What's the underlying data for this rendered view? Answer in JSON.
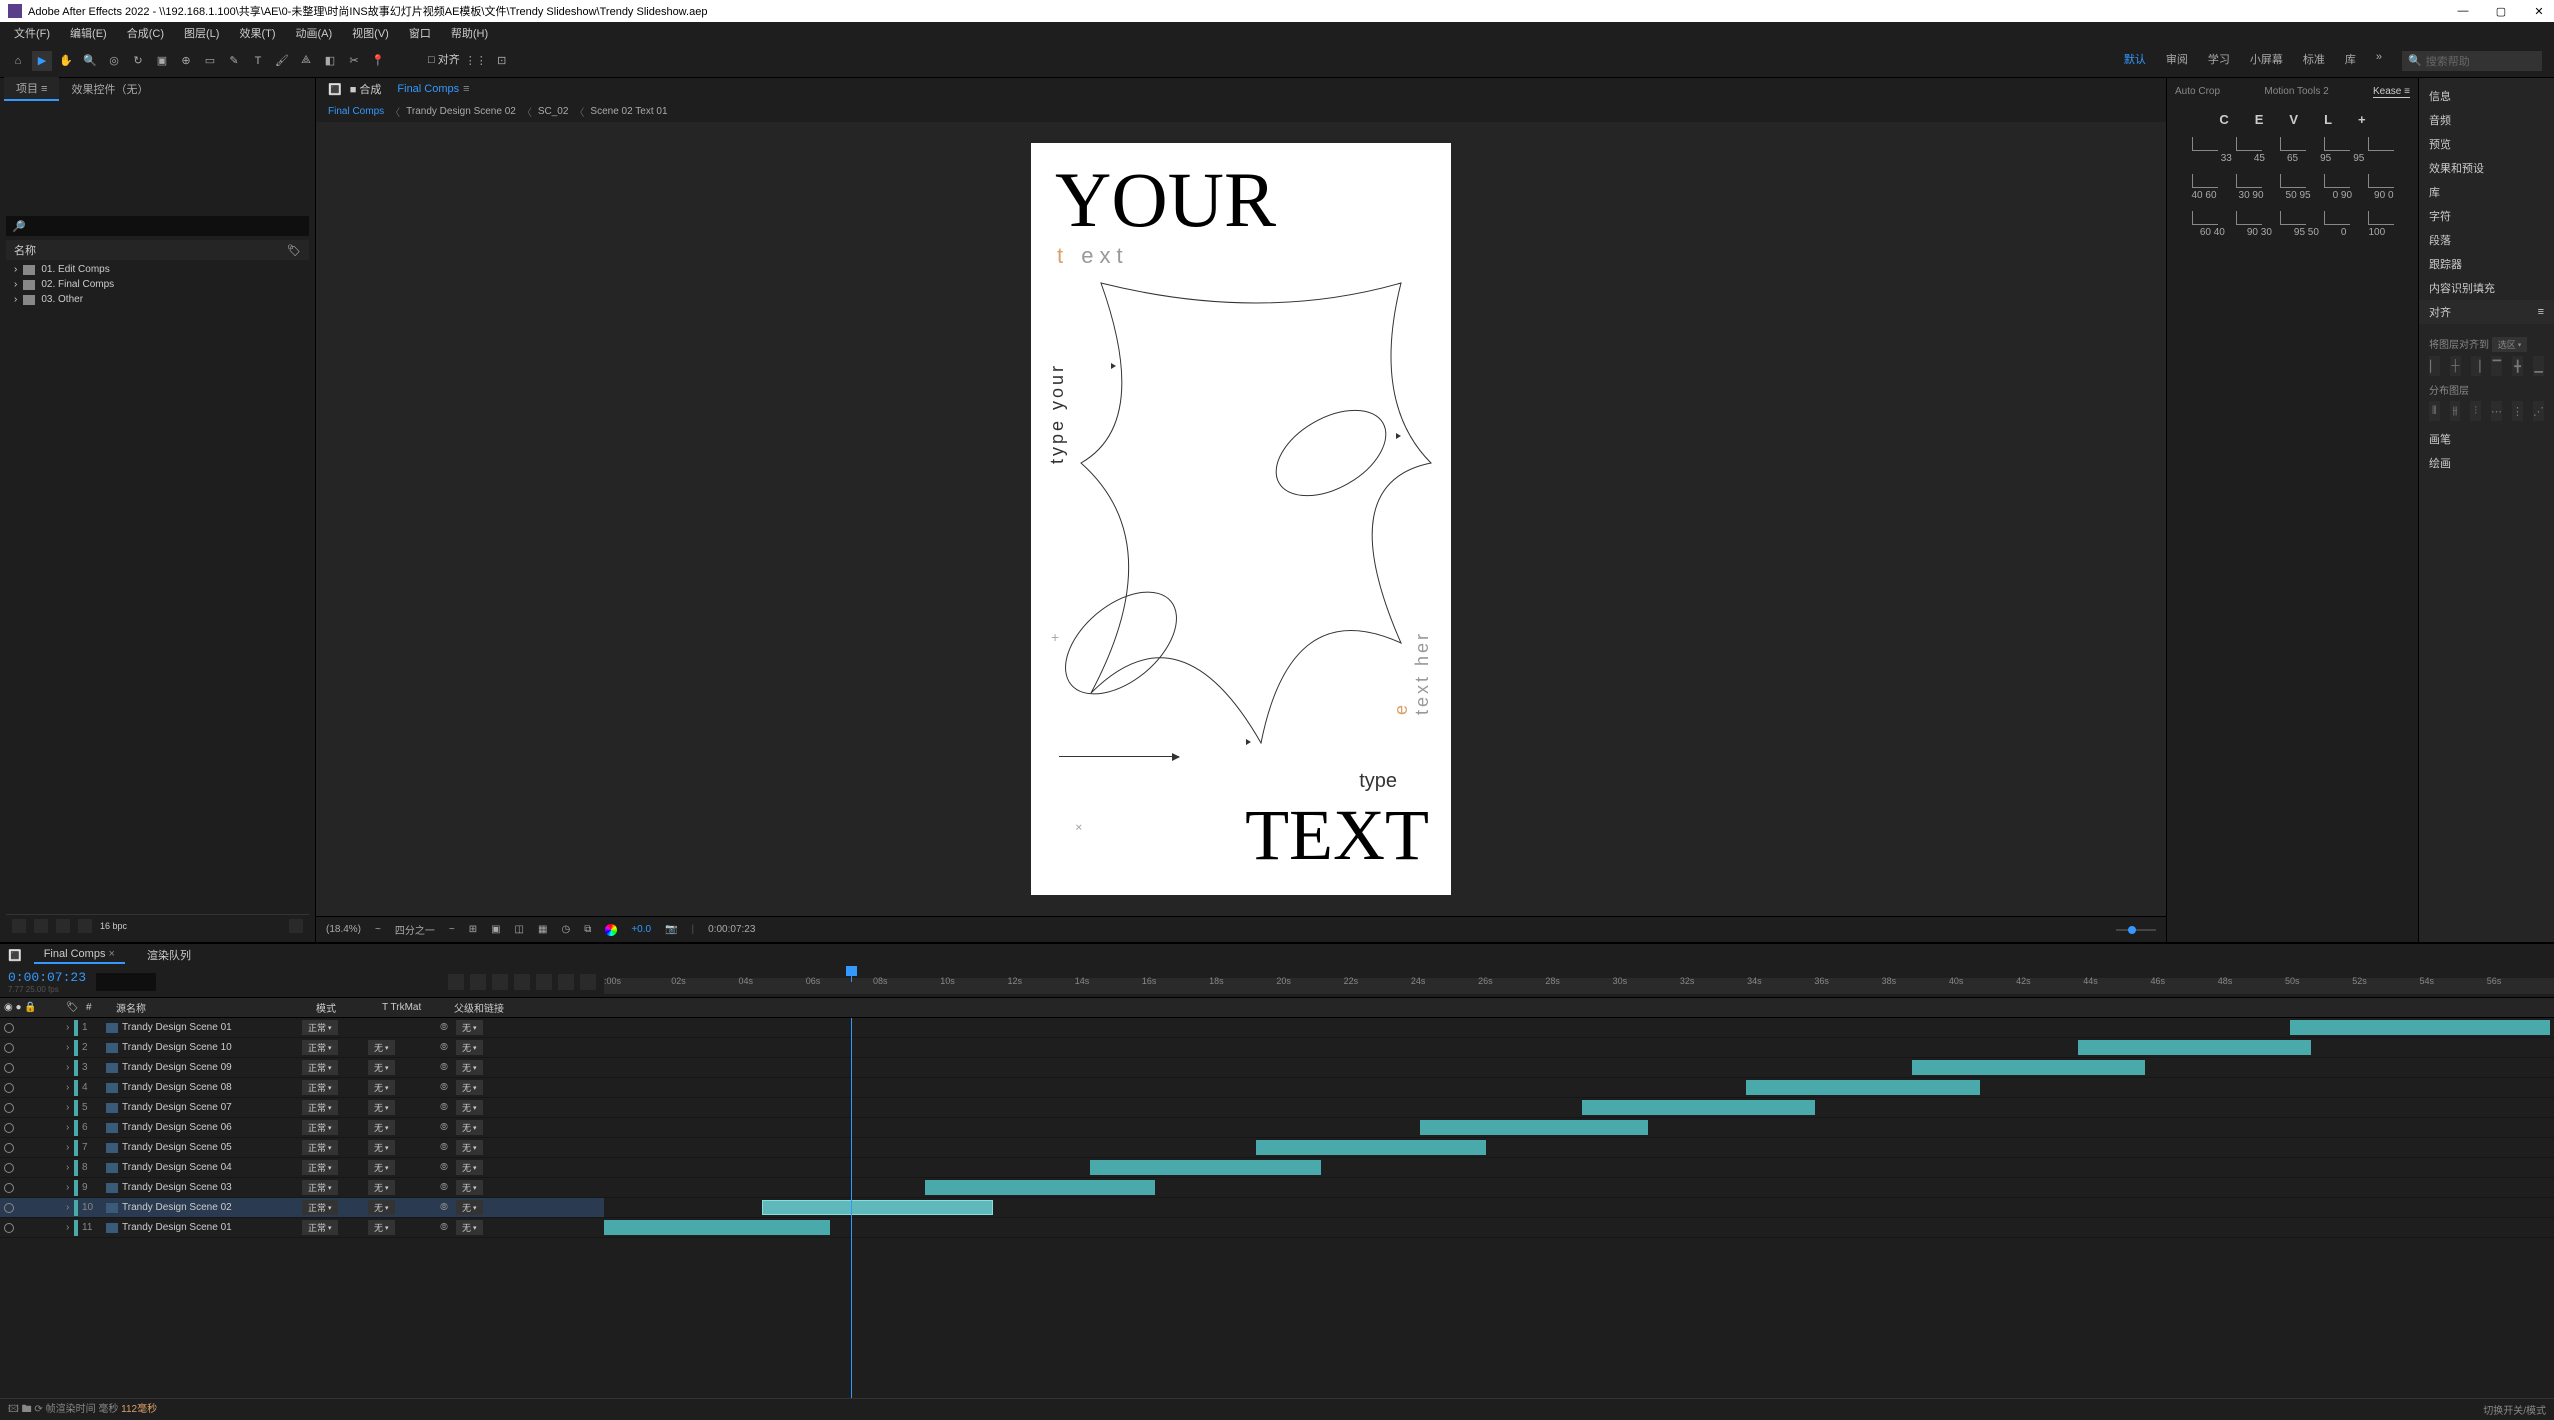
{
  "app": {
    "title": "Adobe After Effects 2022 - \\\\192.168.1.100\\共享\\AE\\0-未整理\\时尚INS故事幻灯片视频AE模板\\文件\\Trendy Slideshow\\Trendy Slideshow.aep"
  },
  "menu": [
    "文件(F)",
    "编辑(E)",
    "合成(C)",
    "图层(L)",
    "效果(T)",
    "动画(A)",
    "视图(V)",
    "窗口",
    "帮助(H)"
  ],
  "toolbar": {
    "snap_label": "□ 对齐",
    "workspaces": [
      "默认",
      "审阅",
      "学习",
      "小屏幕",
      "标准",
      "库"
    ],
    "search_placeholder": "搜索帮助"
  },
  "project": {
    "tab1": "项目 ≡",
    "tab2": "效果控件（无）",
    "header": "名称",
    "items": [
      "01. Edit Comps",
      "02. Final Comps",
      "03. Other"
    ],
    "footer_label": "16 bpc"
  },
  "comp": {
    "prefix": "■ 合成",
    "active_tab": "Final Comps",
    "breadcrumb": [
      "Final Comps",
      "Trandy Design Scene 02",
      "SC_02",
      "Scene 02 Text 01"
    ],
    "canvas": {
      "your": "YOUR",
      "subtext_l": "t ",
      "subtext_r": "ext",
      "vert_left": "type your",
      "vert_right_top": "e",
      "vert_right_bot": "text her",
      "type": "type",
      "big_text": "TEXT"
    },
    "footer": {
      "zoom": "(18.4%)",
      "res": "四分之一",
      "time": "0:00:07:23",
      "plus": "+0.0"
    }
  },
  "right_tabs": [
    "Auto Crop",
    "Motion Tools 2",
    "Kease"
  ],
  "kease": {
    "letters": [
      "C",
      "E",
      "V",
      "L",
      "+"
    ],
    "row1": [
      "33",
      "45",
      "65",
      "95",
      "95"
    ],
    "row2": [
      "40 60",
      "30 90",
      "50 95",
      "0 90",
      "90 0"
    ],
    "row3": [
      "60 40",
      "90 30",
      "95 50",
      "0",
      "100"
    ]
  },
  "right_strip": {
    "items": [
      "信息",
      "音频",
      "预览",
      "效果和预设",
      "库",
      "字符",
      "段落",
      "跟踪器",
      "内容识别填充"
    ],
    "align_header": "对齐",
    "align_sub1": "将图层对齐到",
    "align_sub1_val": "选区",
    "align_sub2": "分布图层",
    "extra": [
      "画笔",
      "绘画"
    ]
  },
  "timeline": {
    "tabs": [
      "Final Comps",
      "渲染队列"
    ],
    "timecode": "0:00:07:23",
    "sub_tc": "7.77  25.00 fps",
    "col_headers": {
      "name": "源名称",
      "mode": "模式",
      "trk": "T  TrkMat",
      "parent": "父级和链接"
    },
    "ruler": [
      ":00s",
      "02s",
      "04s",
      "06s",
      "08s",
      "10s",
      "12s",
      "14s",
      "16s",
      "18s",
      "20s",
      "22s",
      "24s",
      "26s",
      "28s",
      "30s",
      "32s",
      "34s",
      "36s",
      "38s",
      "40s",
      "42s",
      "44s",
      "46s",
      "48s",
      "50s",
      "52s",
      "54s",
      "56s"
    ],
    "layers": [
      {
        "n": 1,
        "name": "Trandy Design Scene 01",
        "mode": "正常",
        "trk": "",
        "parent": "无",
        "clip": [
          2290,
          2550
        ],
        "sel": false
      },
      {
        "n": 2,
        "name": "Trandy Design Scene 10",
        "mode": "正常",
        "trk": "无",
        "parent": "无",
        "clip": [
          2078,
          2311
        ],
        "sel": false
      },
      {
        "n": 3,
        "name": "Trandy Design Scene 09",
        "mode": "正常",
        "trk": "无",
        "parent": "无",
        "clip": [
          1912,
          2145
        ],
        "sel": false
      },
      {
        "n": 4,
        "name": "Trandy Design Scene 08",
        "mode": "正常",
        "trk": "无",
        "parent": "无",
        "clip": [
          1746,
          1980
        ],
        "sel": false
      },
      {
        "n": 5,
        "name": "Trandy Design Scene 07",
        "mode": "正常",
        "trk": "无",
        "parent": "无",
        "clip": [
          1582,
          1815
        ],
        "sel": false
      },
      {
        "n": 6,
        "name": "Trandy Design Scene 06",
        "mode": "正常",
        "trk": "无",
        "parent": "无",
        "clip": [
          1420,
          1648
        ],
        "sel": false
      },
      {
        "n": 7,
        "name": "Trandy Design Scene 05",
        "mode": "正常",
        "trk": "无",
        "parent": "无",
        "clip": [
          1256,
          1486
        ],
        "sel": false
      },
      {
        "n": 8,
        "name": "Trandy Design Scene 04",
        "mode": "正常",
        "trk": "无",
        "parent": "无",
        "clip": [
          1090,
          1321
        ],
        "sel": false
      },
      {
        "n": 9,
        "name": "Trandy Design Scene 03",
        "mode": "正常",
        "trk": "无",
        "parent": "无",
        "clip": [
          925,
          1155
        ],
        "sel": false
      },
      {
        "n": 10,
        "name": "Trandy Design Scene 02",
        "mode": "正常",
        "trk": "无",
        "parent": "无",
        "clip": [
          762,
          993
        ],
        "sel": true
      },
      {
        "n": 11,
        "name": "Trandy Design Scene 01",
        "mode": "正常",
        "trk": "无",
        "parent": "无",
        "clip": [
          604,
          830
        ],
        "sel": false
      }
    ],
    "playhead": 851,
    "footer_l": "帧渲染时间  毫秒",
    "footer_r": "切换开关/模式"
  }
}
